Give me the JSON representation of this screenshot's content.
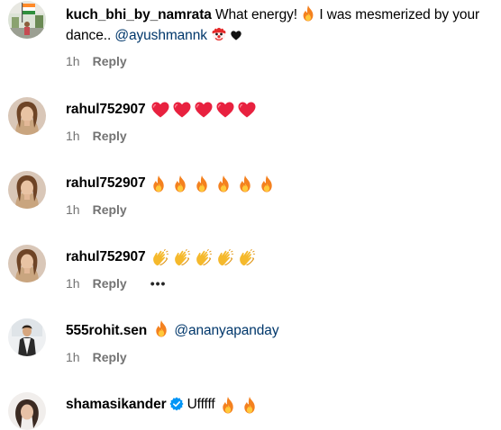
{
  "comments": [
    {
      "username": "kuch_bhi_by_namrata",
      "text_before": " What energy! ",
      "text_middle": " I was mesmerized by your dance.. ",
      "mention": "@ayushmannk",
      "emoji_icons": [
        "fire-icon",
        "clown-face-icon",
        "black-heart-icon"
      ],
      "time": "1h",
      "reply_label": "Reply"
    },
    {
      "username": "rahul752907",
      "emoji_icon": "red-heart-icon",
      "emoji_count": 5,
      "time": "1h",
      "reply_label": "Reply"
    },
    {
      "username": "rahul752907",
      "emoji_icon": "fire-icon",
      "emoji_count": 6,
      "time": "1h",
      "reply_label": "Reply"
    },
    {
      "username": "rahul752907",
      "emoji_icon": "clapping-hands-icon",
      "emoji_count": 5,
      "time": "1h",
      "reply_label": "Reply",
      "more_label": "•••"
    },
    {
      "username": "555rohit.sen",
      "emoji_icon": "fire-icon",
      "mention": "@ananyapanday",
      "time": "1h",
      "reply_label": "Reply"
    },
    {
      "username": "shamasikander",
      "verified": true,
      "text": "Ufffff",
      "emoji_icon": "fire-icon",
      "emoji_count": 2
    }
  ],
  "colors": {
    "text": "#000000",
    "meta": "#737373",
    "mention": "#00376b",
    "verified": "#0095f6",
    "heart": "#e0245e",
    "fire": "#f58220"
  }
}
